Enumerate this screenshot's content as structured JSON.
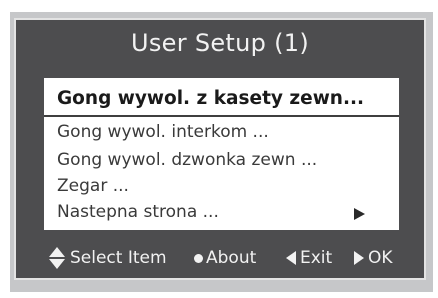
{
  "title": "User Setup  (1)",
  "menu": {
    "items": [
      {
        "label": "Gong wywol. z kasety zewn..."
      },
      {
        "label": "Gong wywol. interkom ..."
      },
      {
        "label": "Gong wywol. dzwonka zewn ..."
      },
      {
        "label": "Zegar ..."
      },
      {
        "label": "Nastepna strona ..."
      }
    ],
    "selected_index": 0
  },
  "footer": {
    "select_label": "Select Item",
    "about_label": "About",
    "exit_label": "Exit",
    "ok_label": "OK"
  },
  "icons": {
    "select": "up-down-arrow-icon",
    "about": "dot-icon",
    "exit": "left-triangle-icon",
    "ok": "right-triangle-icon",
    "next_page": "right-triangle-icon"
  },
  "colors": {
    "panel_bg": "#4d4d4f",
    "menu_bg": "#ffffff",
    "screen_bg": "#c6c7c9",
    "text_light": "#f2f2f2"
  }
}
